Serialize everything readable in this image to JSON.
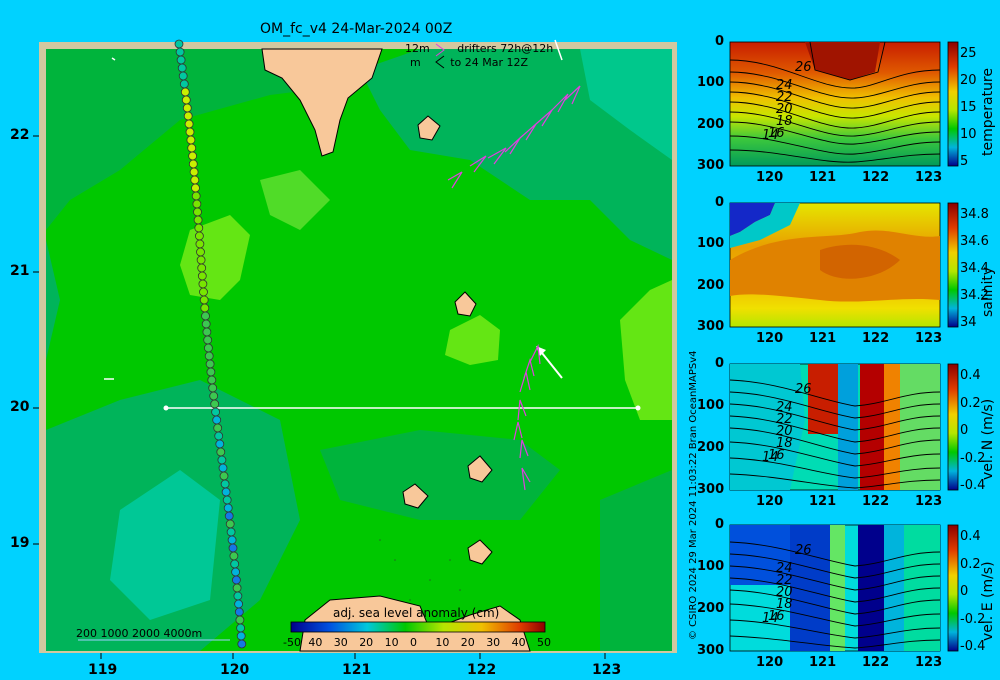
{
  "title": "OM_fc_v4  24-Mar-2024 00Z",
  "legend": {
    "line1_prefix": "12m",
    "line1_text": "drifters 72h@12h",
    "line2_prefix": "m",
    "line2_text": "to 24 Mar 12Z"
  },
  "map": {
    "x_ticks": [
      "119",
      "120",
      "121",
      "122",
      "123"
    ],
    "y_ticks": [
      "22",
      "21",
      "20",
      "19"
    ],
    "depth_legend": "200  1000  2000  4000m",
    "colorbar_label": "adj. sea level anomaly (cm)",
    "colorbar_ticks": [
      "-50",
      "40",
      "30",
      "20",
      "10",
      "0",
      "10",
      "20",
      "30",
      "40",
      "50"
    ],
    "colors": {
      "sea": "#00c800",
      "land": "#f8c89a",
      "frame": "#d2c8a0"
    }
  },
  "credit": "© CSIRO 2024   29 Mar 2024 11:03:22 Bran OceanMAPSv4",
  "panels": [
    {
      "key": "temperature",
      "label": "temperature",
      "y_ticks": [
        "0",
        "100",
        "200",
        "300"
      ],
      "x_ticks": [
        "120",
        "121",
        "122",
        "123"
      ],
      "cb_ticks": [
        "25",
        "20",
        "15",
        "10",
        "5"
      ],
      "contours": [
        "26",
        "24",
        "22",
        "20",
        "18",
        "16",
        "14"
      ]
    },
    {
      "key": "salinity",
      "label": "salinity",
      "y_ticks": [
        "0",
        "100",
        "200",
        "300"
      ],
      "x_ticks": [
        "120",
        "121",
        "122",
        "123"
      ],
      "cb_ticks": [
        "34.8",
        "34.6",
        "34.4",
        "34.2",
        "34"
      ],
      "contours": []
    },
    {
      "key": "vel_n",
      "label": "vel. N (m/s)",
      "y_ticks": [
        "0",
        "100",
        "200",
        "300"
      ],
      "x_ticks": [
        "120",
        "121",
        "122",
        "123"
      ],
      "cb_ticks": [
        "0.4",
        "0.2",
        "0",
        "-0.2",
        "-0.4"
      ],
      "contours": [
        "26",
        "24",
        "22",
        "20",
        "18",
        "16",
        "14"
      ]
    },
    {
      "key": "vel_e",
      "label": "vel. E (m/s)",
      "y_ticks": [
        "0",
        "100",
        "200",
        "300"
      ],
      "x_ticks": [
        "120",
        "121",
        "122",
        "123"
      ],
      "cb_ticks": [
        "0.4",
        "0.2",
        "0",
        "-0.2",
        "-0.4"
      ],
      "contours": [
        "26",
        "24",
        "22",
        "20",
        "18",
        "16",
        "14"
      ]
    }
  ]
}
